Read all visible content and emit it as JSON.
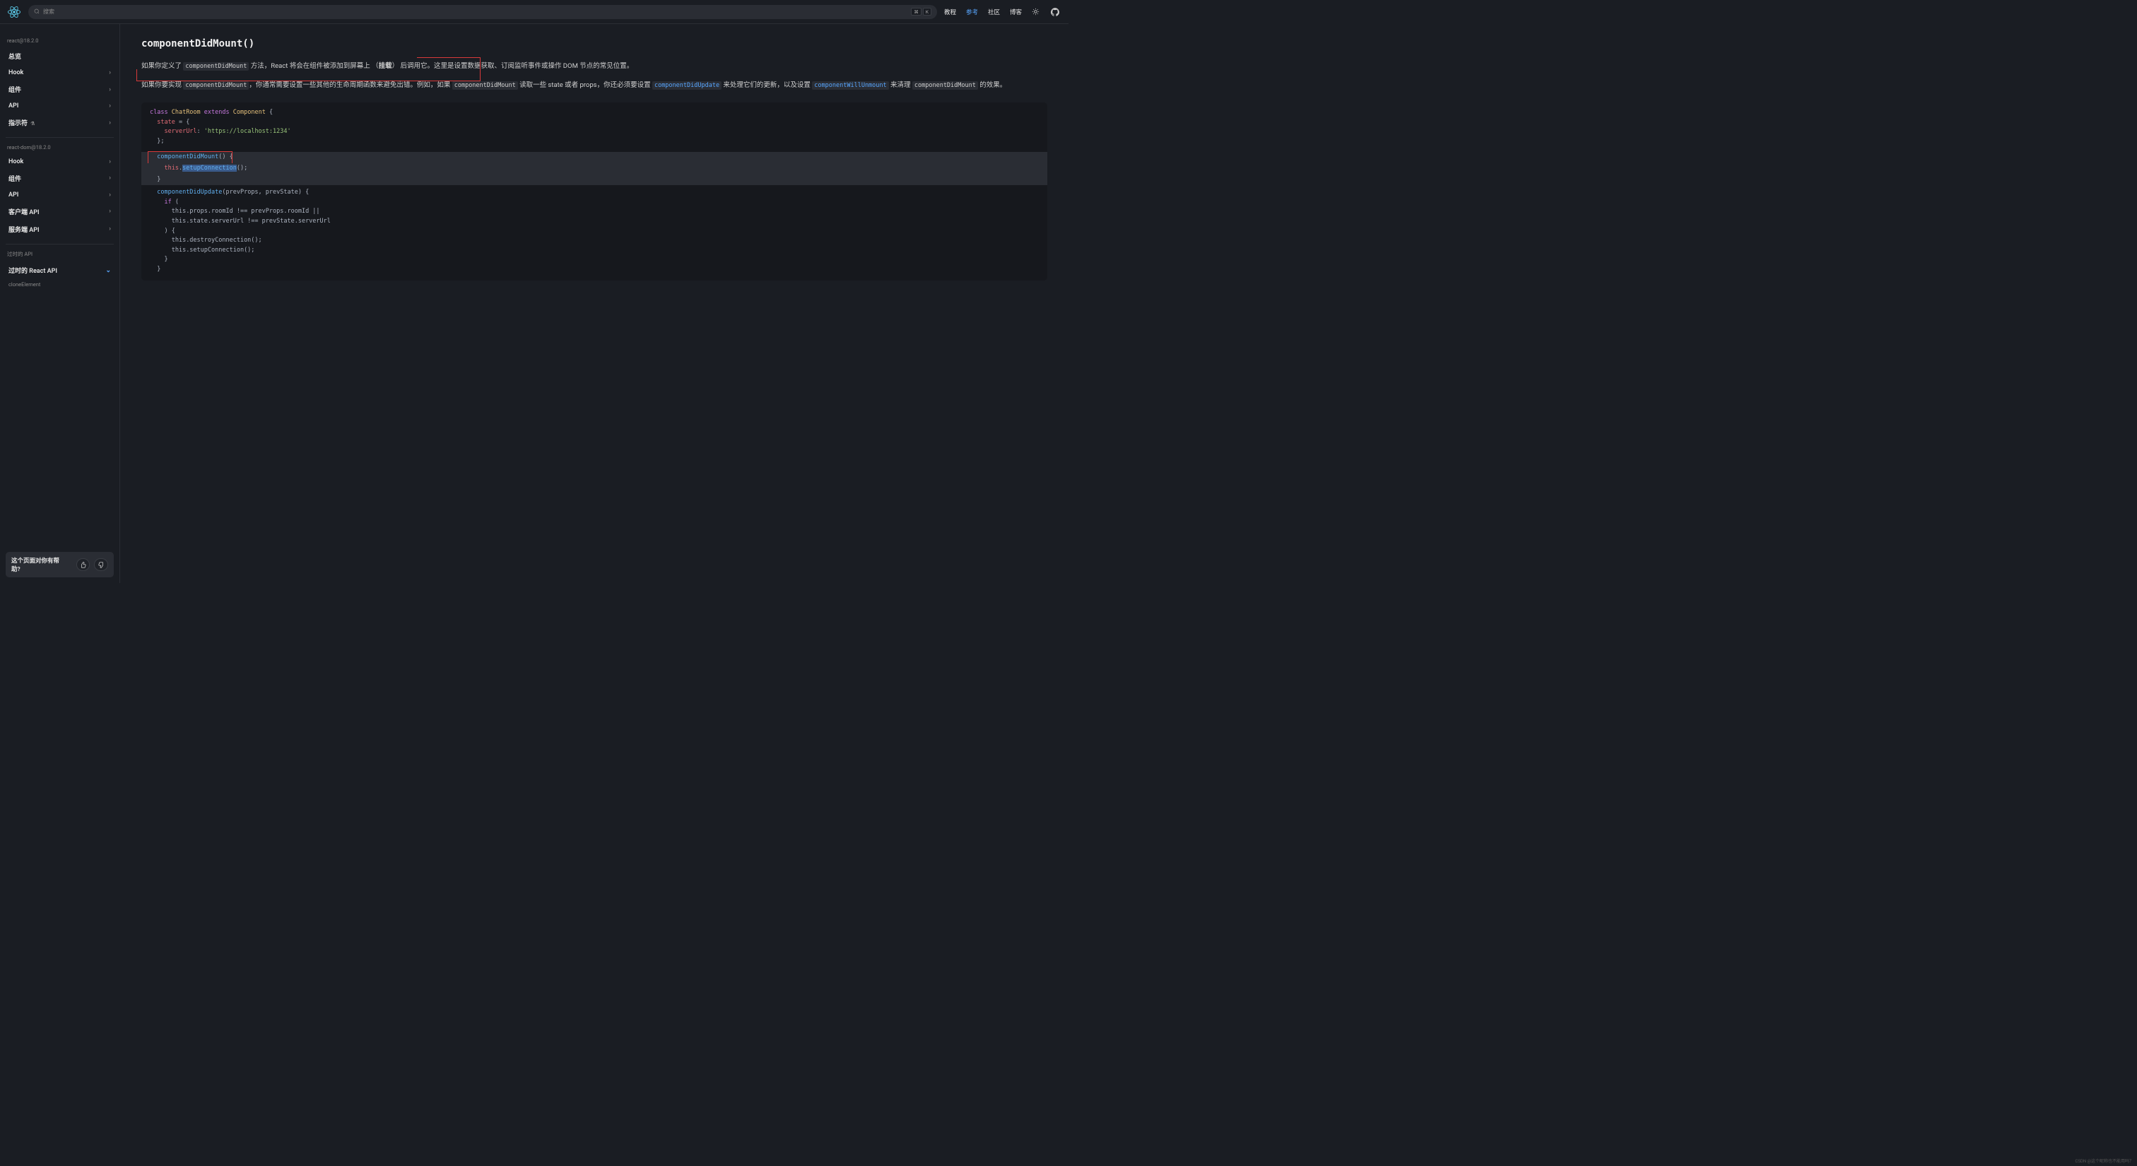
{
  "header": {
    "search_placeholder": "搜索",
    "kbd1": "⌘",
    "kbd2": "K",
    "nav": {
      "tutorial": "教程",
      "reference": "参考",
      "community": "社区",
      "blog": "博客"
    }
  },
  "sidebar": {
    "section1_title": "react@18.2.0",
    "section1_items": [
      "总览",
      "Hook",
      "组件",
      "API",
      "指示符"
    ],
    "section2_title": "react-dom@18.2.0",
    "section2_items": [
      "Hook",
      "组件",
      "API",
      "客户端 API",
      "服务端 API"
    ],
    "section3_title": "过时的 API",
    "section3_items": [
      "过时的 React API"
    ],
    "clone_text": "cloneElement",
    "feedback_text": "这个页面对你有帮助?"
  },
  "main": {
    "heading": "componentDidMount()",
    "para1_prefix": "如果你定义了 ",
    "para1_code1": "componentDidMount",
    "para1_mid": " 方法，React 将会在组件被添加到屏幕上 （",
    "para1_bold": "挂载",
    "para1_after": "） 后调用它。",
    "para1_highlight": "这里是设置数据获取、订阅监听事件或操作 DOM 节点的常见位置。",
    "para2_prefix": "如果你要实现 ",
    "para2_code1": "componentDidMount",
    "para2_mid1": "，你通常需要设置一些其他的生命周期函数来避免出错。例如，如果 ",
    "para2_code2": "componentDidMount",
    "para2_mid2": " 读取一些 state 或者 props，你还必须要设置 ",
    "para2_link1": "componentDidUpdate",
    "para2_mid3": " 来处理它们的更新，以及设置 ",
    "para2_link2": "componentWillUnmount",
    "para2_mid4": " 来清理 ",
    "para2_code3": "componentDidMount",
    "para2_end": " 的效果。"
  },
  "code": {
    "l1_class": "class",
    "l1_name": "ChatRoom",
    "l1_extends": "extends",
    "l1_comp": "Component",
    "l2_state": "state",
    "l3_key": "serverUrl",
    "l3_val": "'https://localhost:1234'",
    "l5_fn": "componentDidMount",
    "l6_this": "this",
    "l6_method": "setupConnection",
    "l8_fn": "componentDidUpdate",
    "l8_args": "(prevProps, prevState)",
    "l9_if": "if",
    "l10": "this.props.roomId !== prevProps.roomId ||",
    "l11": "this.state.serverUrl !== prevState.serverUrl",
    "l13": "this.destroyConnection();",
    "l14": "this.setupConnection();"
  },
  "watermark": "CSDN @这个昵称也不能用吗？"
}
